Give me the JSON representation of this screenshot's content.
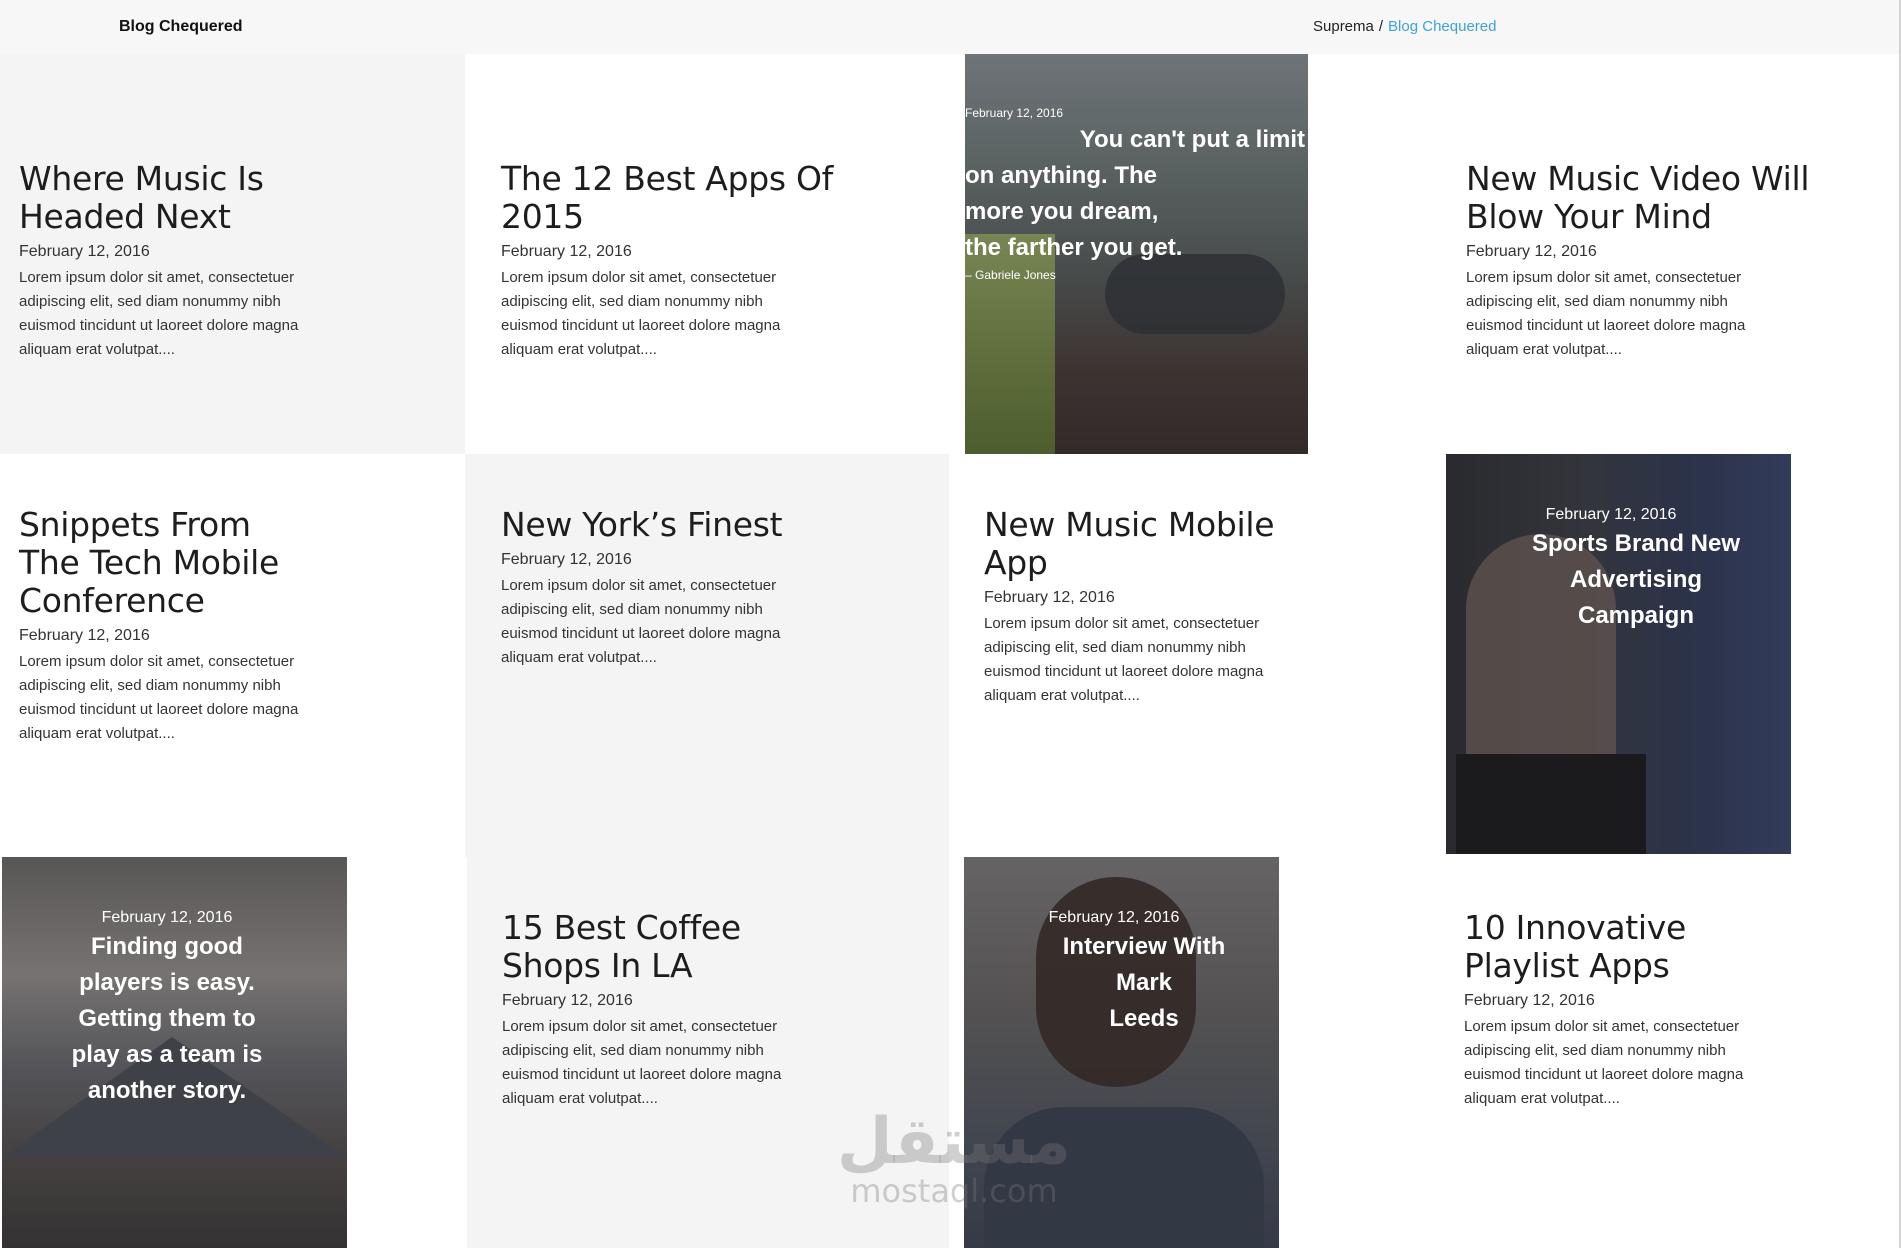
{
  "header": {
    "site_title": "Blog Chequered",
    "breadcrumb": {
      "home": "Suprema",
      "separator": "/",
      "current": "Blog Chequered"
    }
  },
  "posts": [
    {
      "title": "Where Music Is Headed Next",
      "date": "February 12, 2016",
      "excerpt": "Lorem ipsum dolor sit amet, consectetuer adipiscing elit, sed diam nonummy nibh euismod tincidunt ut laoreet dolore magna aliquam erat volutpat...."
    },
    {
      "title": "The 12 Best Apps Of 2015",
      "date": "February 12, 2016",
      "excerpt": "Lorem ipsum dolor sit amet, consectetuer adipiscing elit, sed diam nonummy nibh euismod tincidunt ut laoreet dolore magna aliquam erat volutpat...."
    },
    {
      "title": "New Music Video Will Blow Your Mind",
      "date": "February 12, 2016",
      "excerpt": "Lorem ipsum dolor sit amet, consectetuer adipiscing elit, sed diam nonummy nibh euismod tincidunt ut laoreet dolore magna aliquam erat volutpat...."
    },
    {
      "title": "Snippets From The Tech Mobile Conference",
      "date": "February 12, 2016",
      "excerpt": "Lorem ipsum dolor sit amet, consectetuer adipiscing elit, sed diam nonummy nibh euismod tincidunt ut laoreet dolore magna aliquam erat volutpat...."
    },
    {
      "title": "New York’s Finest",
      "date": "February 12, 2016",
      "excerpt": "Lorem ipsum dolor sit amet, consectetuer adipiscing elit, sed diam nonummy nibh euismod tincidunt ut laoreet dolore magna aliquam erat volutpat...."
    },
    {
      "title": "New Music Mobile App",
      "date": "February 12, 2016",
      "excerpt": "Lorem ipsum dolor sit amet, consectetuer adipiscing elit, sed diam nonummy nibh euismod tincidunt ut laoreet dolore magna aliquam erat volutpat...."
    },
    {
      "title": "15 Best Coffee Shops In LA",
      "date": "February 12, 2016",
      "excerpt": "Lorem ipsum dolor sit amet, consectetuer adipiscing elit, sed diam nonummy nibh euismod tincidunt ut laoreet dolore magna aliquam erat volutpat...."
    },
    {
      "title": "10 Innovative Playlist Apps",
      "date": "February 12, 2016",
      "excerpt": "Lorem ipsum dolor sit amet, consectetuer adipiscing elit, sed diam nonummy nibh euismod tincidunt ut laoreet dolore magna aliquam erat volutpat...."
    }
  ],
  "image_posts": {
    "quote_limit": {
      "date": "February 12, 2016",
      "lines": [
        "You can't put a limit",
        "on anything. The",
        "more you dream,",
        "the farther you get."
      ],
      "author": "– Gabriele Jones"
    },
    "sports_brand": {
      "date": "February 12, 2016",
      "lines": [
        "Sports Brand New",
        "Advertising",
        "Campaign"
      ]
    },
    "finding_players": {
      "date": "February 12, 2016",
      "lines": [
        "Finding good",
        "players is easy.",
        "Getting them to",
        "play as a team is",
        "another story."
      ]
    },
    "interview": {
      "date": "February 12, 2016",
      "lines": [
        "Interview With",
        "Mark",
        "Leeds"
      ]
    }
  },
  "watermark": {
    "arabic": "مستقل",
    "latin": "mostaql.com"
  }
}
